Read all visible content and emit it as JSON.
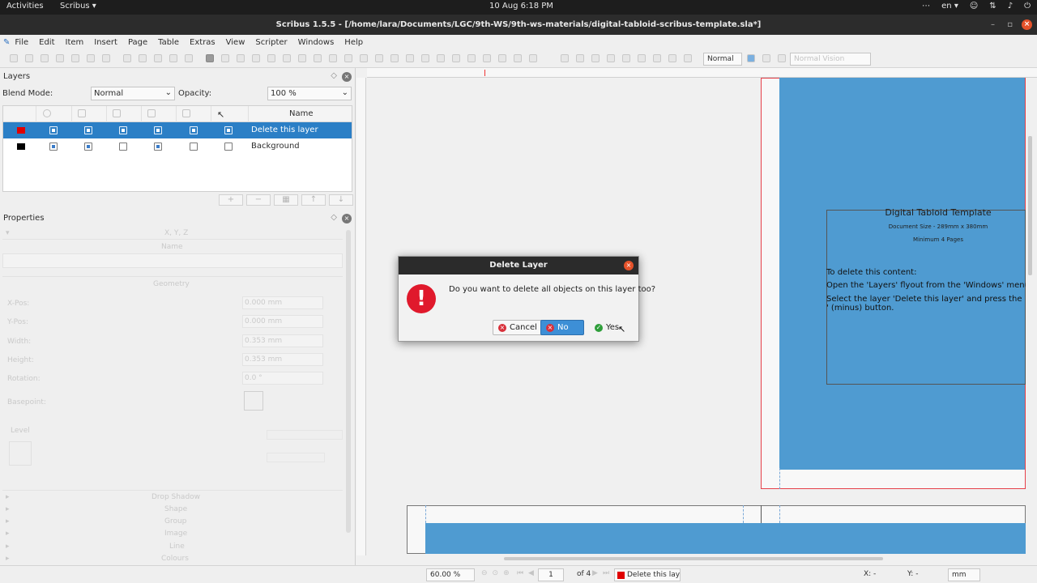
{
  "system_bar": {
    "activities": "Activities",
    "app_menu": "Scribus ▾",
    "clock": "10 Aug  6:18 PM",
    "lang": "en ▾"
  },
  "window": {
    "title": "Scribus 1.5.5 - [/home/lara/Documents/LGC/9th-WS/9th-ws-materials/digital-tabloid-scribus-template.sla*]"
  },
  "menu": [
    "File",
    "Edit",
    "Item",
    "Insert",
    "Page",
    "Table",
    "Extras",
    "View",
    "Scripter",
    "Windows",
    "Help"
  ],
  "toolbar": {
    "mode_select": "Normal",
    "vision_select": "Normal Vision"
  },
  "layers_panel": {
    "title": "Layers",
    "blend_mode_label": "Blend Mode:",
    "blend_mode_value": "Normal",
    "opacity_label": "Opacity:",
    "opacity_value": "100 %",
    "name_header": "Name",
    "layers": [
      {
        "name": "Delete this layer",
        "color": "#e00000"
      },
      {
        "name": "Background",
        "color": "#000000"
      }
    ],
    "buttons": [
      "+",
      "−",
      "▦",
      "↑",
      "↓"
    ]
  },
  "properties_panel": {
    "title": "Properties",
    "xyz": "X, Y, Z",
    "name_label": "Name",
    "geometry": "Geometry",
    "fields": [
      {
        "label": "X-Pos:",
        "value": "0.000 mm"
      },
      {
        "label": "Y-Pos:",
        "value": "0.000 mm"
      },
      {
        "label": "Width:",
        "value": "0.353 mm"
      },
      {
        "label": "Height:",
        "value": "0.353 mm"
      },
      {
        "label": "Rotation:",
        "value": "0.0 °"
      }
    ],
    "basepoint": "Basepoint:",
    "level": "Level",
    "sections": [
      "Drop Shadow",
      "Shape",
      "Group",
      "Image",
      "Line",
      "Colours"
    ]
  },
  "page_content": {
    "template_title": "Digital Tabloid Template",
    "doc_size": "Document Size - 289mm x 380mm",
    "min_pages": "Minimum 4 Pages",
    "instr1": "To delete this content:",
    "instr2": "Open the 'Layers' flyout from the 'Windows' menu",
    "instr3": "Select the layer 'Delete this layer' and press the",
    "instr4": "'  (minus) button."
  },
  "statusbar": {
    "zoom": "60.00 %",
    "page": "1",
    "of_pages": "of 4",
    "current_layer": "Delete this layer",
    "x_label": "X: -",
    "y_label": "Y: -",
    "unit": "mm"
  },
  "dialog": {
    "title": "Delete Layer",
    "message": "Do you want to delete all objects on this layer too?",
    "cancel": "Cancel",
    "no": "No",
    "yes": "Yes"
  }
}
